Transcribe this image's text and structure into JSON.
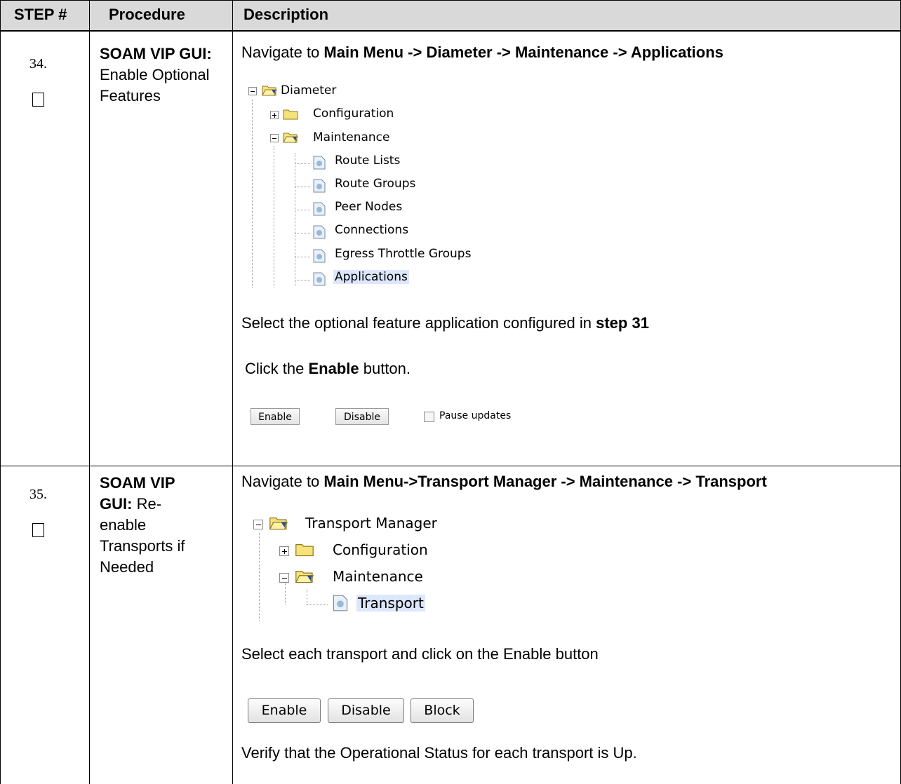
{
  "header": {
    "col_step": "STEP #",
    "col_procedure": "Procedure",
    "col_description": "Description"
  },
  "steps": [
    {
      "number": "34.",
      "procedure_bold": "SOAM VIP GUI:",
      "procedure_rest": "Enable Optional Features",
      "navigate_prefix": "Navigate to ",
      "navigate_path": "Main Menu -> Diameter -> Maintenance -> Applications",
      "tree": {
        "root": "Diameter",
        "configuration": "Configuration",
        "maintenance": "Maintenance",
        "items": [
          "Route Lists",
          "Route Groups",
          "Peer Nodes",
          "Connections",
          "Egress Throttle Groups",
          "Applications"
        ]
      },
      "select_prefix": "Select the optional feature application configured in ",
      "select_bold": "step 31",
      "click_prefix": "Click the ",
      "click_bold": "Enable",
      "click_suffix": " button.",
      "buttons": {
        "enable": "Enable",
        "disable": "Disable",
        "pause_label": "Pause updates"
      }
    },
    {
      "number": "35.",
      "procedure_bold": "SOAM VIP",
      "procedure_bold2": "GUI:",
      "procedure_rest_l1": "Re-",
      "procedure_rest_l2": "enable",
      "procedure_rest_l3": "Transports if",
      "procedure_rest_l4": "Needed",
      "navigate_prefix": "Navigate to ",
      "navigate_path": "Main Menu->Transport Manager -> Maintenance -> Transport",
      "tree": {
        "root": "Transport Manager",
        "configuration": "Configuration",
        "maintenance": "Maintenance",
        "items": [
          "Transport"
        ]
      },
      "select_text": "Select each transport and click on the Enable button",
      "buttons": {
        "enable": "Enable",
        "disable": "Disable",
        "block": "Block"
      },
      "verify_text": "Verify that the Operational Status for each transport is Up."
    }
  ],
  "colors": {
    "header_bg": "#d9d9d9",
    "selected_bg": "#dde7fb",
    "folder_fill": "#f7e27a"
  },
  "icons": [
    "folder-open-icon",
    "folder-closed-icon",
    "page-icon",
    "expand-icon",
    "collapse-icon"
  ]
}
